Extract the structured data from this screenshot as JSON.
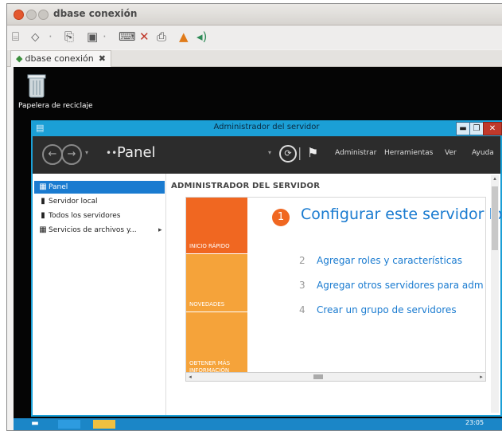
{
  "host_window": {
    "title": "dbase conexión",
    "tab_label": "dbase conexión",
    "tab_close": "✖"
  },
  "toolbar": {
    "icons": [
      "view-icon",
      "connect-icon",
      "copy-icon",
      "monitor-icon",
      "keyboard-icon",
      "disconnect-icon",
      "clipboard-icon",
      "usb-icon",
      "audio-icon"
    ]
  },
  "desktop": {
    "recycle_bin_label": "Papelera de reciclaje"
  },
  "server_manager": {
    "title": "Administrador del servidor",
    "controls": {
      "minimize": "▬",
      "maximize": "❐",
      "close": "✕"
    },
    "nav": {
      "breadcrumb_arrows": "••",
      "breadcrumb": "Panel",
      "menu": [
        "Administrar",
        "Herramientas",
        "Ver",
        "Ayuda"
      ]
    },
    "sidebar": [
      {
        "label": "Panel",
        "icon": "▦",
        "active": true
      },
      {
        "label": "Servidor local",
        "icon": "▮",
        "active": false
      },
      {
        "label": "Todos los servidores",
        "icon": "▮",
        "active": false
      },
      {
        "label": "Servicios de archivos y...",
        "icon": "▦",
        "active": false,
        "arrow": "▸"
      }
    ],
    "main_title": "ADMINISTRADOR DEL SERVIDOR",
    "tiles": [
      "INICIO RÁPIDO",
      "NOVEDADES",
      "OBTENER MÁS INFORMACIÓN"
    ],
    "quickstart": {
      "step1_num": "1",
      "step1": "Configurar este servidor local",
      "steps": [
        {
          "num": "2",
          "label": "Agregar roles y características"
        },
        {
          "num": "3",
          "label": "Agregar otros servidores para adm"
        },
        {
          "num": "4",
          "label": "Crear un grupo de servidores"
        }
      ]
    }
  },
  "taskbar": {
    "clock": "23:05"
  }
}
